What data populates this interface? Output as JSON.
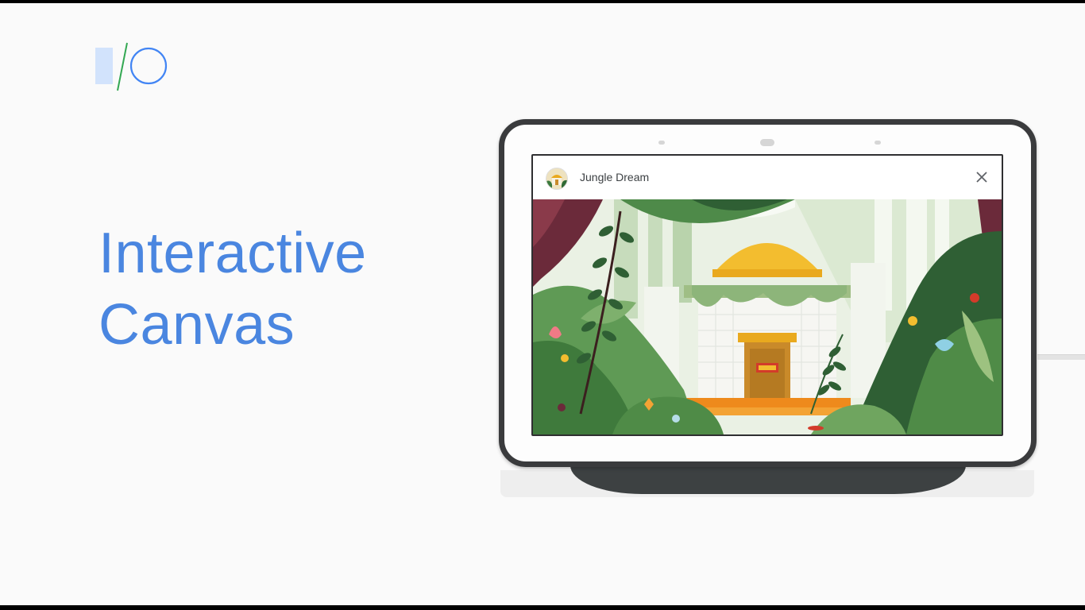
{
  "slide": {
    "title_line1": "Interactive",
    "title_line2": "Canvas"
  },
  "device": {
    "app": {
      "name": "Jungle Dream",
      "icon": "jungle-temple-icon",
      "close_icon": "close-icon"
    }
  },
  "colors": {
    "title_blue": "#4a86e0",
    "logo_light_blue": "#d2e3fc",
    "logo_green": "#34a853",
    "logo_circle_blue": "#4285f4",
    "device_frame": "#3a3b3d",
    "speaker_fabric": "#3d4142"
  }
}
